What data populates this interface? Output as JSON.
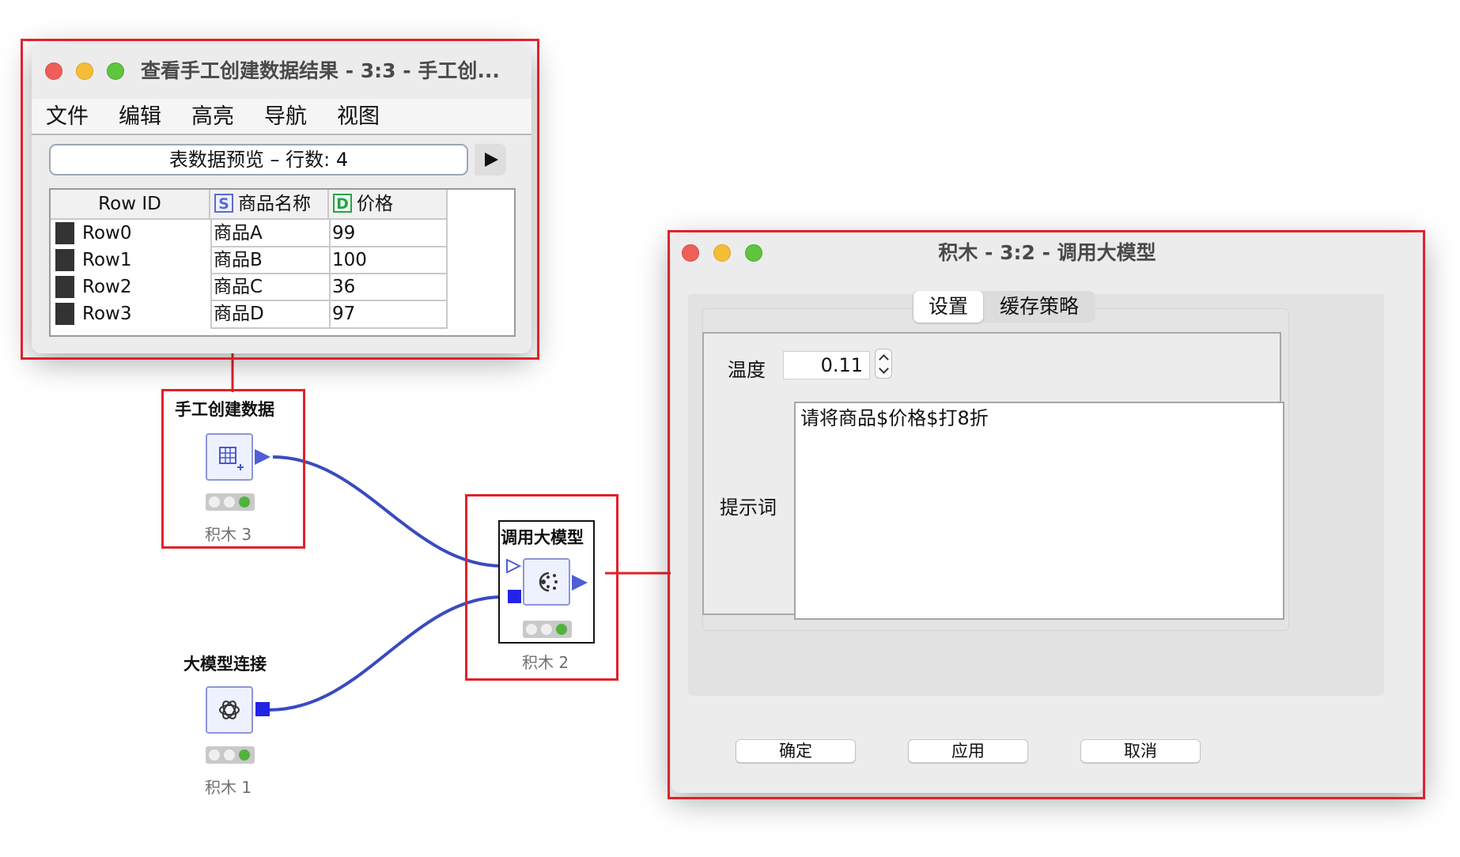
{
  "table_window": {
    "title": "查看手工创建数据结果 - 3:3 - 手工创...",
    "menu": [
      "文件",
      "编辑",
      "高亮",
      "导航",
      "视图"
    ],
    "preview_label": "表数据预览 – 行数: 4",
    "columns": [
      {
        "label": "Row ID",
        "type_badge": ""
      },
      {
        "label": "商品名称",
        "type_badge": "S"
      },
      {
        "label": "价格",
        "type_badge": "D"
      }
    ],
    "rows": [
      {
        "id": "Row0",
        "name": "商品A",
        "price": "99"
      },
      {
        "id": "Row1",
        "name": "商品B",
        "price": "100"
      },
      {
        "id": "Row2",
        "name": "商品C",
        "price": "36"
      },
      {
        "id": "Row3",
        "name": "商品D",
        "price": "97"
      }
    ]
  },
  "workflow": {
    "nodes": [
      {
        "label": "手工创建数据",
        "name": "积木 3",
        "icon": "table-create-icon",
        "status": "executed"
      },
      {
        "label": "调用大模型",
        "name": "积木 2",
        "icon": "llm-call-icon",
        "status": "executed"
      },
      {
        "label": "大模型连接",
        "name": "积木 1",
        "icon": "openai-icon",
        "status": "executed"
      }
    ]
  },
  "config_window": {
    "title": "积木 - 3:2 - 调用大模型",
    "tabs": [
      "设置",
      "缓存策略"
    ],
    "active_tab": "设置",
    "temperature_label": "温度",
    "temperature_value": "0.11",
    "prompt_label": "提示词",
    "prompt_value": "请将商品$价格$打8折",
    "buttons": {
      "ok": "确定",
      "apply": "应用",
      "cancel": "取消"
    }
  },
  "colors": {
    "highlight_border": "#e0222a",
    "connection": "#3a4bbf",
    "port": "#2323e6"
  }
}
